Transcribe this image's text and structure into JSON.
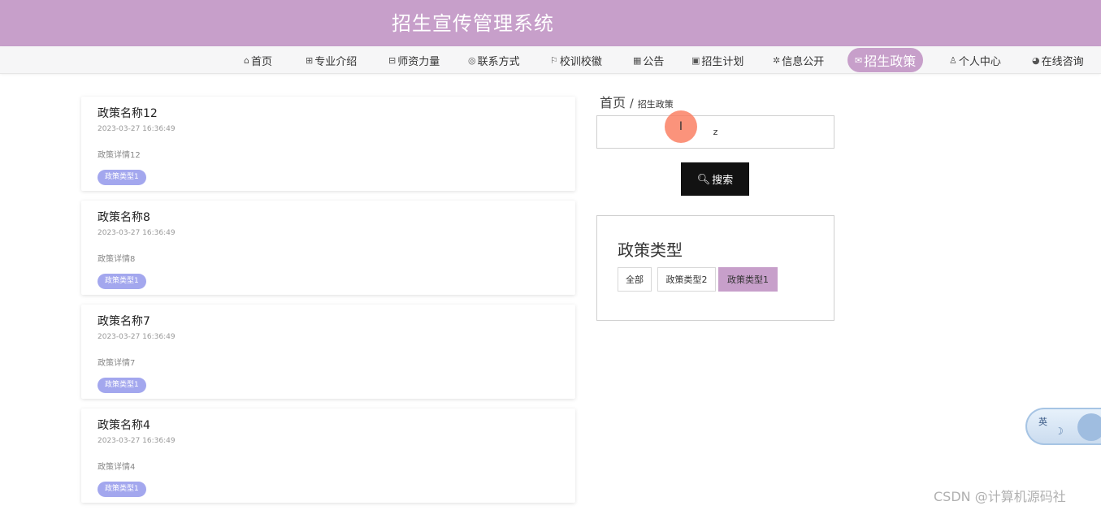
{
  "header": {
    "title": "招生宣传管理系统"
  },
  "nav": [
    {
      "icon": "home-icon",
      "glyph": "⌂",
      "label": "首页"
    },
    {
      "icon": "grid-icon",
      "glyph": "⊞",
      "label": "专业介绍"
    },
    {
      "icon": "teacher-icon",
      "glyph": "⊟",
      "label": "师资力量"
    },
    {
      "icon": "contact-icon",
      "glyph": "◎",
      "label": "联系方式"
    },
    {
      "icon": "flag-icon",
      "glyph": "⚐",
      "label": "校训校徽"
    },
    {
      "icon": "notice-icon",
      "glyph": "▦",
      "label": "公告"
    },
    {
      "icon": "plan-icon",
      "glyph": "▣",
      "label": "招生计划"
    },
    {
      "icon": "info-icon",
      "glyph": "✲",
      "label": "信息公开"
    },
    {
      "icon": "mail-icon",
      "glyph": "✉",
      "label": "招生政策",
      "active": true
    },
    {
      "icon": "user-icon",
      "glyph": "♙",
      "label": "个人中心"
    },
    {
      "icon": "chat-icon",
      "glyph": "◕",
      "label": "在线咨询"
    }
  ],
  "policies": [
    {
      "title": "政策名称12",
      "time": "2023-03-27 16:36:49",
      "detail": "政策详情12",
      "tag": "政策类型1"
    },
    {
      "title": "政策名称8",
      "time": "2023-03-27 16:36:49",
      "detail": "政策详情8",
      "tag": "政策类型1"
    },
    {
      "title": "政策名称7",
      "time": "2023-03-27 16:36:49",
      "detail": "政策详情7",
      "tag": "政策类型1"
    },
    {
      "title": "政策名称4",
      "time": "2023-03-27 16:36:49",
      "detail": "政策详情4",
      "tag": "政策类型1"
    }
  ],
  "breadcrumb": {
    "home": "首页",
    "separator": "/",
    "current": "招生政策"
  },
  "search": {
    "value": "z",
    "button_label": "搜索",
    "button_icon": "search-icon"
  },
  "types": {
    "title": "政策类型",
    "options": [
      {
        "label": "全部",
        "active": false
      },
      {
        "label": "政策类型2",
        "active": false
      },
      {
        "label": "政策类型1",
        "active": true
      }
    ]
  },
  "ime": {
    "label": "英"
  },
  "watermark": "CSDN @计算机源码社",
  "colors": {
    "header": "#c79fca",
    "tag": "#a3a7ee",
    "search_button": "#121212",
    "active_type": "#c79fca"
  }
}
